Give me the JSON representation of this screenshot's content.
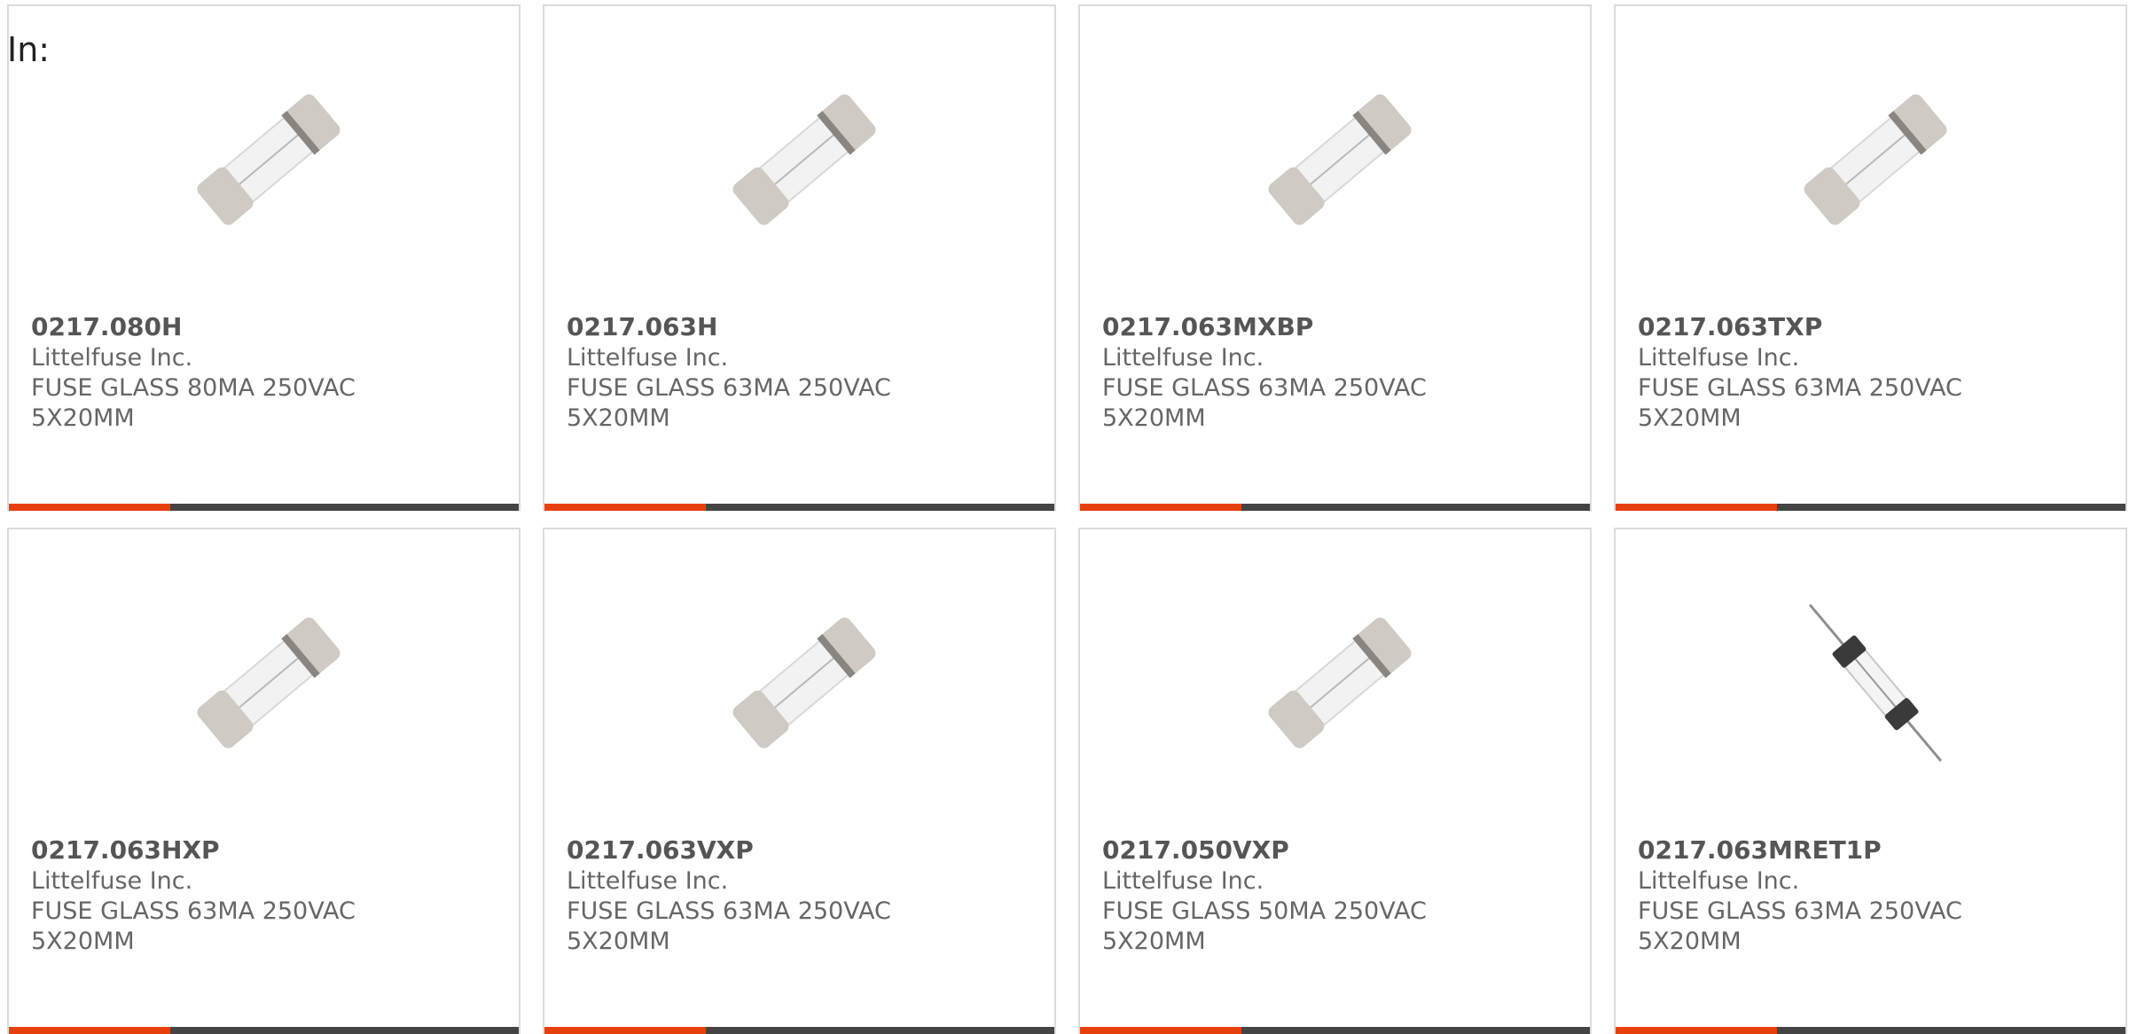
{
  "prefix_label": "In:",
  "accent_color": "#e8400c",
  "bar_color": "#444444",
  "products": [
    {
      "part_number": "0217.080H",
      "manufacturer": "Littelfuse Inc.",
      "description": "FUSE GLASS 80MA 250VAC 5X20MM",
      "image": "glass-fuse-cartridge"
    },
    {
      "part_number": "0217.063H",
      "manufacturer": "Littelfuse Inc.",
      "description": "FUSE GLASS 63MA 250VAC 5X20MM",
      "image": "glass-fuse-cartridge"
    },
    {
      "part_number": "0217.063MXBP",
      "manufacturer": "Littelfuse Inc.",
      "description": "FUSE GLASS 63MA 250VAC 5X20MM",
      "image": "glass-fuse-cartridge"
    },
    {
      "part_number": "0217.063TXP",
      "manufacturer": "Littelfuse Inc.",
      "description": "FUSE GLASS 63MA 250VAC 5X20MM",
      "image": "glass-fuse-cartridge"
    },
    {
      "part_number": "0217.063HXP",
      "manufacturer": "Littelfuse Inc.",
      "description": "FUSE GLASS 63MA 250VAC 5X20MM",
      "image": "glass-fuse-cartridge"
    },
    {
      "part_number": "0217.063VXP",
      "manufacturer": "Littelfuse Inc.",
      "description": "FUSE GLASS 63MA 250VAC 5X20MM",
      "image": "glass-fuse-cartridge"
    },
    {
      "part_number": "0217.050VXP",
      "manufacturer": "Littelfuse Inc.",
      "description": "FUSE GLASS 50MA 250VAC 5X20MM",
      "image": "glass-fuse-cartridge"
    },
    {
      "part_number": "0217.063MRET1P",
      "manufacturer": "Littelfuse Inc.",
      "description": "FUSE GLASS 63MA 250VAC 5X20MM",
      "image": "glass-fuse-axial-leads"
    }
  ]
}
